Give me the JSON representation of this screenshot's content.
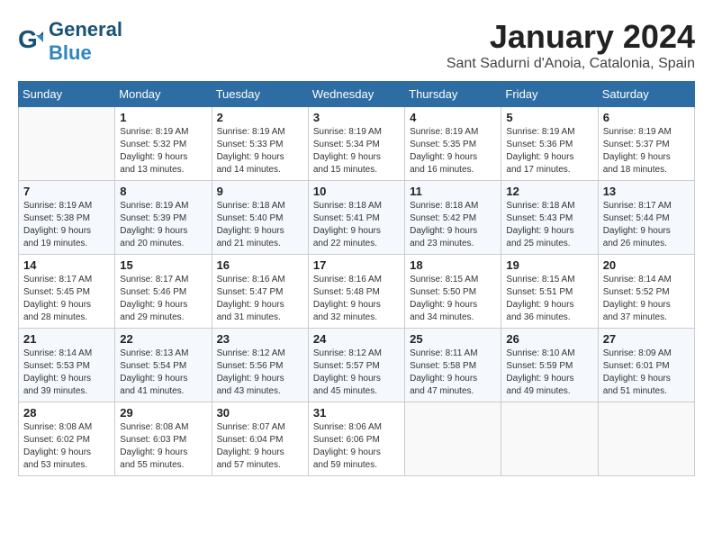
{
  "header": {
    "logo_general": "General",
    "logo_blue": "Blue",
    "month_title": "January 2024",
    "subtitle": "Sant Sadurni d'Anoia, Catalonia, Spain"
  },
  "weekdays": [
    "Sunday",
    "Monday",
    "Tuesday",
    "Wednesday",
    "Thursday",
    "Friday",
    "Saturday"
  ],
  "weeks": [
    [
      {
        "day": "",
        "info": ""
      },
      {
        "day": "1",
        "info": "Sunrise: 8:19 AM\nSunset: 5:32 PM\nDaylight: 9 hours\nand 13 minutes."
      },
      {
        "day": "2",
        "info": "Sunrise: 8:19 AM\nSunset: 5:33 PM\nDaylight: 9 hours\nand 14 minutes."
      },
      {
        "day": "3",
        "info": "Sunrise: 8:19 AM\nSunset: 5:34 PM\nDaylight: 9 hours\nand 15 minutes."
      },
      {
        "day": "4",
        "info": "Sunrise: 8:19 AM\nSunset: 5:35 PM\nDaylight: 9 hours\nand 16 minutes."
      },
      {
        "day": "5",
        "info": "Sunrise: 8:19 AM\nSunset: 5:36 PM\nDaylight: 9 hours\nand 17 minutes."
      },
      {
        "day": "6",
        "info": "Sunrise: 8:19 AM\nSunset: 5:37 PM\nDaylight: 9 hours\nand 18 minutes."
      }
    ],
    [
      {
        "day": "7",
        "info": "Sunrise: 8:19 AM\nSunset: 5:38 PM\nDaylight: 9 hours\nand 19 minutes."
      },
      {
        "day": "8",
        "info": "Sunrise: 8:19 AM\nSunset: 5:39 PM\nDaylight: 9 hours\nand 20 minutes."
      },
      {
        "day": "9",
        "info": "Sunrise: 8:18 AM\nSunset: 5:40 PM\nDaylight: 9 hours\nand 21 minutes."
      },
      {
        "day": "10",
        "info": "Sunrise: 8:18 AM\nSunset: 5:41 PM\nDaylight: 9 hours\nand 22 minutes."
      },
      {
        "day": "11",
        "info": "Sunrise: 8:18 AM\nSunset: 5:42 PM\nDaylight: 9 hours\nand 23 minutes."
      },
      {
        "day": "12",
        "info": "Sunrise: 8:18 AM\nSunset: 5:43 PM\nDaylight: 9 hours\nand 25 minutes."
      },
      {
        "day": "13",
        "info": "Sunrise: 8:17 AM\nSunset: 5:44 PM\nDaylight: 9 hours\nand 26 minutes."
      }
    ],
    [
      {
        "day": "14",
        "info": "Sunrise: 8:17 AM\nSunset: 5:45 PM\nDaylight: 9 hours\nand 28 minutes."
      },
      {
        "day": "15",
        "info": "Sunrise: 8:17 AM\nSunset: 5:46 PM\nDaylight: 9 hours\nand 29 minutes."
      },
      {
        "day": "16",
        "info": "Sunrise: 8:16 AM\nSunset: 5:47 PM\nDaylight: 9 hours\nand 31 minutes."
      },
      {
        "day": "17",
        "info": "Sunrise: 8:16 AM\nSunset: 5:48 PM\nDaylight: 9 hours\nand 32 minutes."
      },
      {
        "day": "18",
        "info": "Sunrise: 8:15 AM\nSunset: 5:50 PM\nDaylight: 9 hours\nand 34 minutes."
      },
      {
        "day": "19",
        "info": "Sunrise: 8:15 AM\nSunset: 5:51 PM\nDaylight: 9 hours\nand 36 minutes."
      },
      {
        "day": "20",
        "info": "Sunrise: 8:14 AM\nSunset: 5:52 PM\nDaylight: 9 hours\nand 37 minutes."
      }
    ],
    [
      {
        "day": "21",
        "info": "Sunrise: 8:14 AM\nSunset: 5:53 PM\nDaylight: 9 hours\nand 39 minutes."
      },
      {
        "day": "22",
        "info": "Sunrise: 8:13 AM\nSunset: 5:54 PM\nDaylight: 9 hours\nand 41 minutes."
      },
      {
        "day": "23",
        "info": "Sunrise: 8:12 AM\nSunset: 5:56 PM\nDaylight: 9 hours\nand 43 minutes."
      },
      {
        "day": "24",
        "info": "Sunrise: 8:12 AM\nSunset: 5:57 PM\nDaylight: 9 hours\nand 45 minutes."
      },
      {
        "day": "25",
        "info": "Sunrise: 8:11 AM\nSunset: 5:58 PM\nDaylight: 9 hours\nand 47 minutes."
      },
      {
        "day": "26",
        "info": "Sunrise: 8:10 AM\nSunset: 5:59 PM\nDaylight: 9 hours\nand 49 minutes."
      },
      {
        "day": "27",
        "info": "Sunrise: 8:09 AM\nSunset: 6:01 PM\nDaylight: 9 hours\nand 51 minutes."
      }
    ],
    [
      {
        "day": "28",
        "info": "Sunrise: 8:08 AM\nSunset: 6:02 PM\nDaylight: 9 hours\nand 53 minutes."
      },
      {
        "day": "29",
        "info": "Sunrise: 8:08 AM\nSunset: 6:03 PM\nDaylight: 9 hours\nand 55 minutes."
      },
      {
        "day": "30",
        "info": "Sunrise: 8:07 AM\nSunset: 6:04 PM\nDaylight: 9 hours\nand 57 minutes."
      },
      {
        "day": "31",
        "info": "Sunrise: 8:06 AM\nSunset: 6:06 PM\nDaylight: 9 hours\nand 59 minutes."
      },
      {
        "day": "",
        "info": ""
      },
      {
        "day": "",
        "info": ""
      },
      {
        "day": "",
        "info": ""
      }
    ]
  ]
}
